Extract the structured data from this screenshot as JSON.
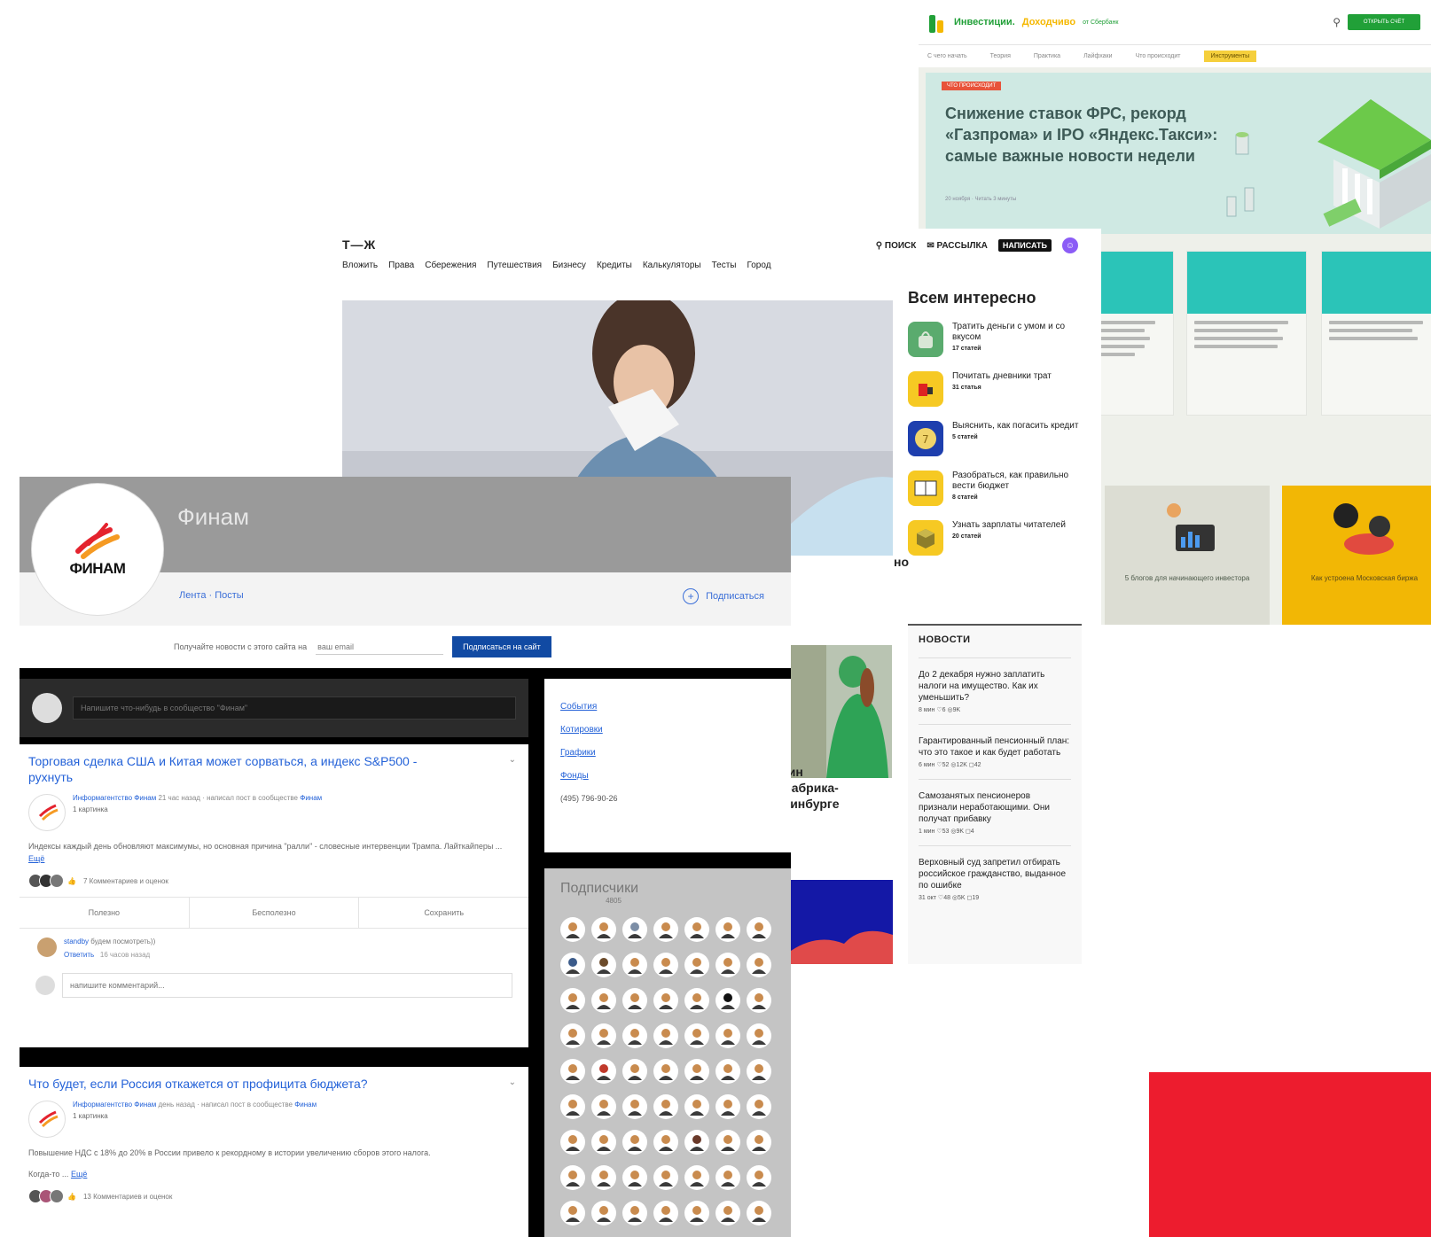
{
  "investments": {
    "brand": "Инвестиции.",
    "brand_accent": "Доходчиво",
    "brand_tag": "от Сбербанк",
    "login_label": "ОТКРЫТЬ СЧЁТ",
    "nav": [
      "С чего начать",
      "Теория",
      "Практика",
      "Лайфхаки",
      "Что происходит",
      "Инструменты"
    ],
    "hero_tag": "ЧТО ПРОИСХОДИТ",
    "hero_title": "Снижение ставок ФРС, рекорд «Газпрома» и IPO «Яндекс.Такси»: самые важные новости недели",
    "hero_meta": "20 ноября · Читать 3 минуты",
    "small_cards": [
      "5 блогов для начинающего инвестора",
      "Как устроена Московская биржа"
    ],
    "colors": {
      "green": "#21a038",
      "hero_bg": "#cfe9e3",
      "yellow": "#f5b800"
    }
  },
  "tj": {
    "logo": "Т—Ж",
    "search_label": "ПОИСК",
    "mail_label": "РАССЫЛКА",
    "write_label": "НАПИСАТЬ",
    "nav": [
      "Вложить",
      "Права",
      "Сбережения",
      "Путешествия",
      "Бизнесу",
      "Кредиты",
      "Калькуляторы",
      "Тесты",
      "Город"
    ],
    "side_title": "Всем интересно",
    "topics": [
      {
        "title": "Тратить деньги с умом и со вкусом",
        "count": "17 статей",
        "color": "#5aab6e"
      },
      {
        "title": "Почитать дневники трат",
        "count": "31 статья",
        "color": "#f6c923"
      },
      {
        "title": "Выяснить, как погасить кредит",
        "count": "5 статей",
        "color": "#1e3fae"
      },
      {
        "title": "Разобраться, как правильно вести бюджет",
        "count": "8 статей",
        "color": "#f6c923"
      },
      {
        "title": "Узнать зарплаты читателей",
        "count": "20 статей",
        "color": "#f6c923"
      }
    ],
    "news_title": "НОВОСТИ",
    "news": [
      {
        "title": "До 2 декабря нужно заплатить налоги на имущество. Как их уменьшить?",
        "meta": "8 мин ♡6 ◎9K"
      },
      {
        "title": "Гарантированный пенсионный план: что это такое и как будет работать",
        "meta": "6 мин ♡52 ◎12K ◻42"
      },
      {
        "title": "Самозанятых пенсионеров признали неработающими. Они получат прибавку",
        "meta": "1 мин ♡53 ◎9K ◻4"
      },
      {
        "title": "Верховный суд запретил отбирать российское гражданство, выданное по ошибке",
        "meta": "31 окт ♡48 ◎5K ◻19"
      }
    ],
    "fragments": {
      "f1": "но",
      "f2": "газин",
      "f3": "и фабрика-",
      "f4": "теринбурге"
    }
  },
  "finam": {
    "page_name": "Финам",
    "logo_text": "ФИНАМ",
    "profile_links": "Лента · Посты",
    "subscribe_label": "Подписаться",
    "email_prompt": "Получайте новости с этого сайта на",
    "email_placeholder": "ваш email",
    "email_button": "Подписаться на сайт",
    "composer_placeholder": "Напишите что-нибудь в сообщество \"Финам\"",
    "posts": [
      {
        "title": "Торговая сделка США и Китая может сорваться, а индекс S&P500 - рухнуть",
        "author": "Информагентство Финам",
        "author_meta": "21 час назад · написал пост в сообществе",
        "community": "Финам",
        "attachment": "1 картинка",
        "body": "Индексы каждый день обновляют максимумы, но основная причина \"ралли\" - словесные интервенции Трампа. Лайткайперы ...",
        "more": "Ещё",
        "reactions": "7 Комментариев и оценок",
        "actions": [
          "Полезно",
          "Бесполезно",
          "Сохранить"
        ],
        "comment_author": "standby",
        "comment_text": "будем посмотреть))",
        "comment_reply": "Ответить",
        "comment_meta": "16 часов назад",
        "reply_placeholder": "напишите комментарий..."
      },
      {
        "title": "Что будет, если Россия откажется от профицита бюджета?",
        "author": "Информагентство Финам",
        "author_meta": "день назад · написал пост в сообществе",
        "community": "Финам",
        "attachment": "1 картинка",
        "body": "Повышение НДС с 18% до 20% в России привело к рекордному в истории увеличению сборов этого налога.",
        "body2": "Когда-то ...",
        "more": "Ещё",
        "reactions": "13 Комментариев и оценок"
      }
    ],
    "info_links": [
      "События",
      "Котировки",
      "Графики",
      "Фонды"
    ],
    "phone": "(495) 796-90-26",
    "subscribers_title": "Подписчики",
    "subscribers_count": "4805",
    "colors": {
      "link": "#2462d8",
      "button": "#114aa3"
    }
  },
  "red_block_color": "#ed1c2e"
}
